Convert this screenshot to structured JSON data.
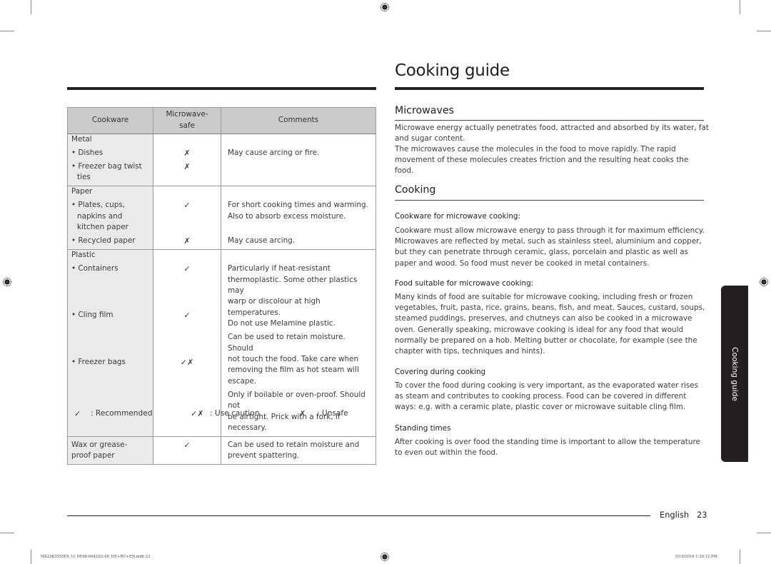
{
  "page": {
    "title": "Cooking guide",
    "footer": {
      "language": "English",
      "page_number": "23"
    },
    "slug_left": "MS23K3555ES_LI_DE68-04422G-00_HE+RU+EN.indb   23",
    "slug_right": "5/10/2016   1:30:12 PM",
    "side_tab_label": "Cooking guide"
  },
  "table": {
    "headers": {
      "cookware": "Cookware",
      "microwave_safe_line1": "Microwave-",
      "microwave_safe_line2": "safe",
      "comments": "Comments"
    },
    "groups": [
      {
        "category": "Metal",
        "items": [
          {
            "name_lines": [
              "• Dishes"
            ],
            "safe": "✗",
            "comment_lines": [
              "May cause arcing or fire."
            ]
          },
          {
            "name_lines": [
              "• Freezer bag twist",
              "ties"
            ],
            "safe": "✗",
            "comment_lines": []
          }
        ]
      },
      {
        "category": "Paper",
        "items": [
          {
            "name_lines": [
              "• Plates, cups,",
              "napkins and",
              "kitchen paper"
            ],
            "safe": "✓",
            "comment_lines": [
              "For short cooking times and warming.",
              "Also to absorb excess moisture."
            ]
          },
          {
            "name_lines": [
              "• Recycled paper"
            ],
            "safe": "✗",
            "comment_lines": [
              "May cause arcing."
            ]
          }
        ]
      },
      {
        "category": "Plastic",
        "items": [
          {
            "name_lines": [
              "• Containers"
            ],
            "safe": "✓",
            "comment_lines": [
              "Particularly if heat-resistant",
              "thermoplastic. Some other plastics may",
              "warp or discolour at high temperatures.",
              "Do not use Melamine plastic."
            ]
          },
          {
            "name_lines": [
              "• Cling film"
            ],
            "safe": "✓",
            "comment_lines": [
              "Can be used to retain moisture. Should",
              "not touch the food. Take care when",
              "removing the film as hot steam will",
              "escape."
            ]
          },
          {
            "name_lines": [
              "• Freezer bags"
            ],
            "safe": "✓✗",
            "comment_lines": [
              "Only if boilable or oven-proof. Should not",
              "be airtight. Prick with a fork, if necessary."
            ]
          }
        ]
      },
      {
        "category": null,
        "items": [
          {
            "name_lines": [
              "Wax or grease-",
              "proof paper"
            ],
            "safe": "✓",
            "comment_lines": [
              "Can be used to retain moisture and",
              "prevent spattering."
            ]
          }
        ]
      }
    ]
  },
  "legend": [
    {
      "symbol": "✓",
      "label": ": Recommended"
    },
    {
      "symbol": "✓✗",
      "label": ": Use caution"
    },
    {
      "symbol": "✗",
      "label": ": Unsafe"
    }
  ],
  "sections": {
    "microwaves": {
      "heading": "Microwaves",
      "p1": "Microwave energy actually penetrates food, attracted and absorbed by its water, fat and sugar content.",
      "p2": "The microwaves cause the molecules in the food to move rapidly. The rapid movement of these molecules creates friction and the resulting heat cooks the food."
    },
    "cooking": {
      "heading": "Cooking",
      "cookware_sub": "Cookware for microwave cooking:",
      "cookware_text": "Cookware must allow microwave energy to pass through it for maximum efficiency. Microwaves are reflected by metal, such as stainless steel, aluminium and copper, but they can penetrate through ceramic, glass, porcelain and plastic as well as paper and wood. So food must never be cooked in metal containers.",
      "food_sub": "Food suitable for microwave cooking:",
      "food_text": "Many kinds of food are suitable for microwave cooking, including fresh or frozen vegetables, fruit, pasta, rice, grains, beans, fish, and meat. Sauces, custard, soups, steamed puddings, preserves, and chutneys can also be cooked in a microwave oven. Generally speaking, microwave cooking is ideal for any food that would normally be prepared on a hob. Melting butter or chocolate, for example (see the chapter with tips, techniques and hints).",
      "covering_sub": "Covering during cooking",
      "covering_text": "To cover the food during cooking is very important, as the evaporated water rises as steam and contributes to cooking process. Food can be covered in different ways: e.g. with a ceramic plate, plastic cover or microwave suitable cling film.",
      "standing_sub": "Standing times",
      "standing_text": "After cooking is over food the standing time is important to allow the temperature to even out within the food."
    }
  }
}
